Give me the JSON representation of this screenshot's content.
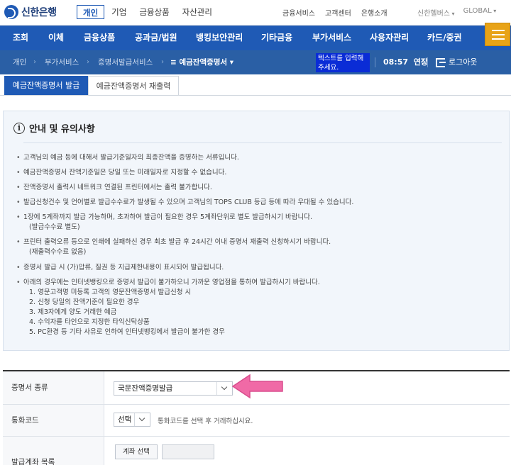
{
  "brand": {
    "name": "신한은행"
  },
  "top_nav": {
    "items": [
      "개인",
      "기업",
      "금융상품",
      "자산관리"
    ],
    "active": "개인"
  },
  "top_links": [
    "금융서비스",
    "고객센터",
    "은행소개"
  ],
  "top_right": [
    "신한헬버스",
    "GLOBAL"
  ],
  "main_nav": [
    "조회",
    "이체",
    "금융상품",
    "공과금/법원",
    "뱅킹보안관리",
    "기타금융",
    "부가서비스",
    "사용자관리",
    "카드/중권"
  ],
  "breadcrumb": {
    "items": [
      "개인",
      "부가서비스",
      "증명서발급서비스"
    ],
    "current": "예금잔액증명서"
  },
  "tooltip": "텍스트를 입력해주세요.",
  "session": {
    "time": "08:57",
    "extend": "연장",
    "logout": "로그아웃"
  },
  "tabs": [
    "예금잔액증명서 발급",
    "예금잔액증명서 재출력"
  ],
  "notice": {
    "title": "안내 및 유의사항",
    "items": [
      "고객님의 예금 등에 대해서 발급기준일자의 최종잔액을 증명하는 서류입니다.",
      "예금잔액증명서 잔액기준일은 당일 또는 미래일자로 지정할 수 없습니다.",
      "잔액증명서 출력시 네트워크 연결된 프린터에서는 출력 불가합니다.",
      "발급신청건수 및 언어별로 발급수수료가 발생될 수 있으며 고객님의 TOPS CLUB 등급 등에 따라 우대될 수 있습니다.",
      "1장에 5계좌까지 발급 가능하며, 초과하여 발급이 필요한 경우 5계좌단위로 별도 발급하시기 바랍니다.",
      "프린터 출력오류 등으로 인쇄에 실패하신 경우 최초 발급 후 24시간 이내 증명서 재출력 신청하시기 바랍니다.",
      "증명서 발급 시 (가)압류, 질권 등 지급제한내용이 표시되어 발급됩니다.",
      "아래의 경우에는 인터넷뱅킹으로 증명서 발급이 불가하오니 가까운 영업점을 통하여 발급하시기 바랍니다."
    ],
    "sub_fee_1": "(발급수수료 별도)",
    "sub_fee_2": "(재출력수수료 없음)",
    "exceptions": [
      "1. 영문고객명 미등록 고객의 영문잔액증명서 발급신청 시",
      "2. 신청 당일의 잔액기준이 필요한 경우",
      "3. 제3자에게 양도 거래한 예금",
      "4. 수익자를 타인으로 지정한 타익신탁상품",
      "5. PC환경 등 기타 사유로 인하여 인터넷뱅킹에서 발급이 불가한 경우"
    ]
  },
  "form": {
    "cert_type_label": "증명서 종류",
    "cert_type_value": "국문잔액증명발급",
    "currency_label": "통화코드",
    "currency_value": "선택",
    "currency_hint": "통화코드를 선택 후 거래하십시요.",
    "account_label": "발급계좌 목록",
    "account_button": "계좌 선택"
  },
  "colors": {
    "primary": "#1f5ab5",
    "menu_button": "#e8a317",
    "highlight_arrow": "#f06aa6"
  }
}
